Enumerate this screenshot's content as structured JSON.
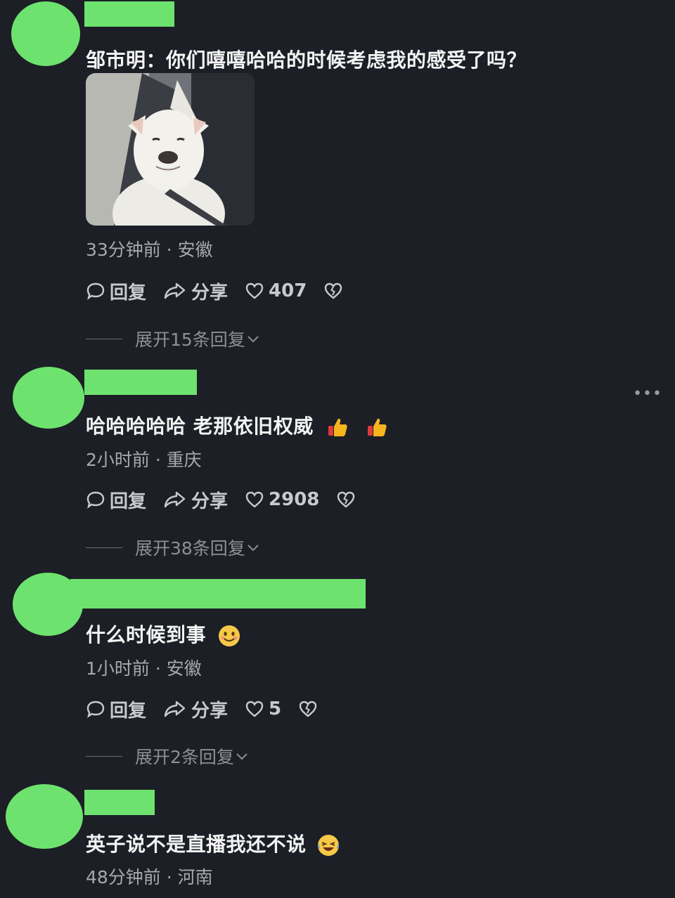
{
  "comments": [
    {
      "text": "邹市明：你们嘻嘻哈哈的时候考虑我的感受了吗？",
      "meta": "33分钟前 · 安徽",
      "reply_label": "回复",
      "share_label": "分享",
      "likes": "407",
      "expand": "展开15条回复"
    },
    {
      "text": "哈哈哈哈哈 老那依旧权威",
      "meta": "2小时前 · 重庆",
      "reply_label": "回复",
      "share_label": "分享",
      "likes": "2908",
      "expand": "展开38条回复"
    },
    {
      "text": "什么时候到事",
      "meta": "1小时前 · 安徽",
      "reply_label": "回复",
      "share_label": "分享",
      "likes": "5",
      "expand": "展开2条回复"
    },
    {
      "text": "英子说不是直播我还不说",
      "meta": "48分钟前 · 河南"
    }
  ],
  "colors": {
    "background": "#1c1f26",
    "avatar_redaction": "#6ee26e",
    "meta_text": "#a7a9ae"
  },
  "icons": [
    "reply-bubble-icon",
    "share-arrow-icon",
    "heart-icon",
    "broken-heart-icon",
    "chevron-down-icon",
    "more-dots-icon",
    "thumbs-up-emoji",
    "smile-emoji",
    "laughing-tears-emoji"
  ]
}
